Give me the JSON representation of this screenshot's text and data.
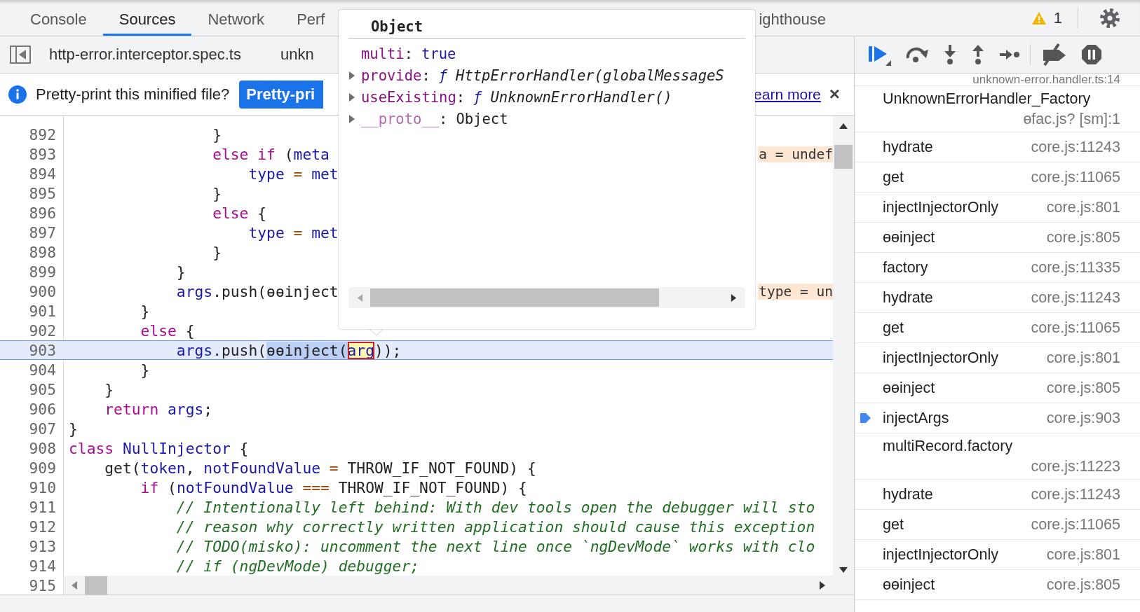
{
  "tabs": [
    {
      "label": "Console",
      "selected": false
    },
    {
      "label": "Sources",
      "selected": true
    },
    {
      "label": "Network",
      "selected": false
    },
    {
      "label": "Perf",
      "selected": false
    },
    {
      "label": "ighthouse",
      "selected": false
    }
  ],
  "warnings": {
    "count": "1"
  },
  "file_tabs": [
    {
      "label": "http-error.interceptor.spec.ts"
    },
    {
      "label": "unkn"
    }
  ],
  "infobar": {
    "message": "Pretty-print this minified file?",
    "button": "Pretty-pri",
    "link": "earn more",
    "close": "×"
  },
  "code": {
    "lines": [
      {
        "number": "892",
        "current": false,
        "tokens": [
          {
            "text": "                }",
            "kind": "plain"
          }
        ]
      },
      {
        "number": "893",
        "current": false,
        "tokens": [
          {
            "text": "                else if",
            "kind": "keyword"
          },
          {
            "text": " (",
            "kind": "plain"
          },
          {
            "text": "meta",
            "kind": "variable"
          }
        ],
        "inline_value": "a = undef"
      },
      {
        "number": "894",
        "current": false,
        "tokens": [
          {
            "text": "                    type",
            "kind": "variable"
          },
          {
            "text": " = ",
            "kind": "operator"
          },
          {
            "text": "met",
            "kind": "variable"
          }
        ]
      },
      {
        "number": "895",
        "current": false,
        "tokens": [
          {
            "text": "                }",
            "kind": "plain"
          }
        ]
      },
      {
        "number": "896",
        "current": false,
        "tokens": [
          {
            "text": "                else",
            "kind": "keyword"
          },
          {
            "text": " {",
            "kind": "plain"
          }
        ]
      },
      {
        "number": "897",
        "current": false,
        "tokens": [
          {
            "text": "                    type",
            "kind": "variable"
          },
          {
            "text": " = ",
            "kind": "operator"
          },
          {
            "text": "met",
            "kind": "variable"
          }
        ]
      },
      {
        "number": "898",
        "current": false,
        "tokens": [
          {
            "text": "                }",
            "kind": "plain"
          }
        ]
      },
      {
        "number": "899",
        "current": false,
        "tokens": [
          {
            "text": "            }",
            "kind": "plain"
          }
        ]
      },
      {
        "number": "900",
        "current": false,
        "tokens": [
          {
            "text": "            args",
            "kind": "variable"
          },
          {
            "text": ".push(ɵɵinject",
            "kind": "plain"
          }
        ],
        "inline_value": "type = un"
      },
      {
        "number": "901",
        "current": false,
        "tokens": [
          {
            "text": "        }",
            "kind": "plain"
          }
        ]
      },
      {
        "number": "902",
        "current": false,
        "tokens": [
          {
            "text": "        else",
            "kind": "keyword"
          },
          {
            "text": " {",
            "kind": "plain"
          }
        ]
      },
      {
        "number": "903",
        "current": true,
        "tokens": [
          {
            "text": "            args",
            "kind": "variable"
          },
          {
            "text": ".push(",
            "kind": "plain"
          },
          {
            "text": "ɵɵinject(",
            "kind": "plain",
            "selected": true
          },
          {
            "text": "arg",
            "kind": "variable",
            "hovered": true
          },
          {
            "text": "));",
            "kind": "plain"
          }
        ]
      },
      {
        "number": "904",
        "current": false,
        "tokens": [
          {
            "text": "        }",
            "kind": "plain"
          }
        ]
      },
      {
        "number": "905",
        "current": false,
        "tokens": [
          {
            "text": "    }",
            "kind": "plain"
          }
        ]
      },
      {
        "number": "906",
        "current": false,
        "tokens": [
          {
            "text": "    return",
            "kind": "keyword"
          },
          {
            "text": " args",
            "kind": "variable"
          },
          {
            "text": ";",
            "kind": "plain"
          }
        ]
      },
      {
        "number": "907",
        "current": false,
        "tokens": [
          {
            "text": "}",
            "kind": "plain"
          }
        ]
      },
      {
        "number": "908",
        "current": false,
        "tokens": [
          {
            "text": "class",
            "kind": "keyword"
          },
          {
            "text": " NullInjector",
            "kind": "variable"
          },
          {
            "text": " {",
            "kind": "plain"
          }
        ]
      },
      {
        "number": "909",
        "current": false,
        "tokens": [
          {
            "text": "    get(",
            "kind": "plain"
          },
          {
            "text": "token",
            "kind": "variable"
          },
          {
            "text": ", ",
            "kind": "plain"
          },
          {
            "text": "notFoundValue",
            "kind": "variable"
          },
          {
            "text": " = ",
            "kind": "operator"
          },
          {
            "text": "THROW_IF_NOT_FOUND) {",
            "kind": "plain"
          }
        ]
      },
      {
        "number": "910",
        "current": false,
        "tokens": [
          {
            "text": "        if",
            "kind": "keyword"
          },
          {
            "text": " (",
            "kind": "plain"
          },
          {
            "text": "notFoundValue",
            "kind": "variable"
          },
          {
            "text": " === ",
            "kind": "operator"
          },
          {
            "text": "THROW_IF_NOT_FOUND) {",
            "kind": "plain"
          }
        ]
      },
      {
        "number": "911",
        "current": false,
        "tokens": [
          {
            "text": "            // Intentionally left behind: With dev tools open the debugger will sto",
            "kind": "comment"
          }
        ]
      },
      {
        "number": "912",
        "current": false,
        "tokens": [
          {
            "text": "            // reason why correctly written application should cause this exception",
            "kind": "comment"
          }
        ]
      },
      {
        "number": "913",
        "current": false,
        "tokens": [
          {
            "text": "            // TODO(misko): uncomment the next line once `ngDevMode` works with clo",
            "kind": "comment"
          }
        ]
      },
      {
        "number": "914",
        "current": false,
        "tokens": [
          {
            "text": "            // if (ngDevMode) debugger;",
            "kind": "comment"
          }
        ]
      }
    ],
    "last_line_number": "915"
  },
  "popup": {
    "title": "Object",
    "properties": [
      {
        "key": "multi",
        "separator": ":",
        "expandable": false,
        "internal": false,
        "kind": "boolean",
        "value": "true"
      },
      {
        "key": "provide",
        "separator": ":",
        "expandable": true,
        "internal": false,
        "kind": "function",
        "prefix": "ƒ",
        "value": "HttpErrorHandler(globalMessageS"
      },
      {
        "key": "useExisting",
        "separator": ":",
        "expandable": true,
        "internal": false,
        "kind": "function",
        "prefix": "ƒ",
        "value": "UnknownErrorHandler()"
      },
      {
        "key": "__proto__",
        "separator": ":",
        "expandable": true,
        "internal": true,
        "kind": "object",
        "value": "Object"
      }
    ]
  },
  "call_stack": [
    {
      "location": "unknown-error.handler.ts:14",
      "current": false
    },
    {
      "name": "UnknownErrorHandler_Factory",
      "location": "ɵfac.js? [sm]:1",
      "current": false
    },
    {
      "name": "hydrate",
      "location": "core.js:11243",
      "current": false
    },
    {
      "name": "get",
      "location": "core.js:11065",
      "current": false
    },
    {
      "name": "injectInjectorOnly",
      "location": "core.js:801",
      "current": false
    },
    {
      "name": "ɵɵinject",
      "location": "core.js:805",
      "current": false
    },
    {
      "name": "factory",
      "location": "core.js:11335",
      "current": false
    },
    {
      "name": "hydrate",
      "location": "core.js:11243",
      "current": false
    },
    {
      "name": "get",
      "location": "core.js:11065",
      "current": false
    },
    {
      "name": "injectInjectorOnly",
      "location": "core.js:801",
      "current": false
    },
    {
      "name": "ɵɵinject",
      "location": "core.js:805",
      "current": false
    },
    {
      "name": "injectArgs",
      "location": "core.js:903",
      "current": true
    },
    {
      "name": "multiRecord.factory",
      "location": "core.js:11223",
      "current": false
    },
    {
      "name": "hydrate",
      "location": "core.js:11243",
      "current": false
    },
    {
      "name": "get",
      "location": "core.js:11065",
      "current": false
    },
    {
      "name": "injectInjectorOnly",
      "location": "core.js:801",
      "current": false
    },
    {
      "name": "ɵɵinject",
      "location": "core.js:805",
      "current": false
    }
  ]
}
